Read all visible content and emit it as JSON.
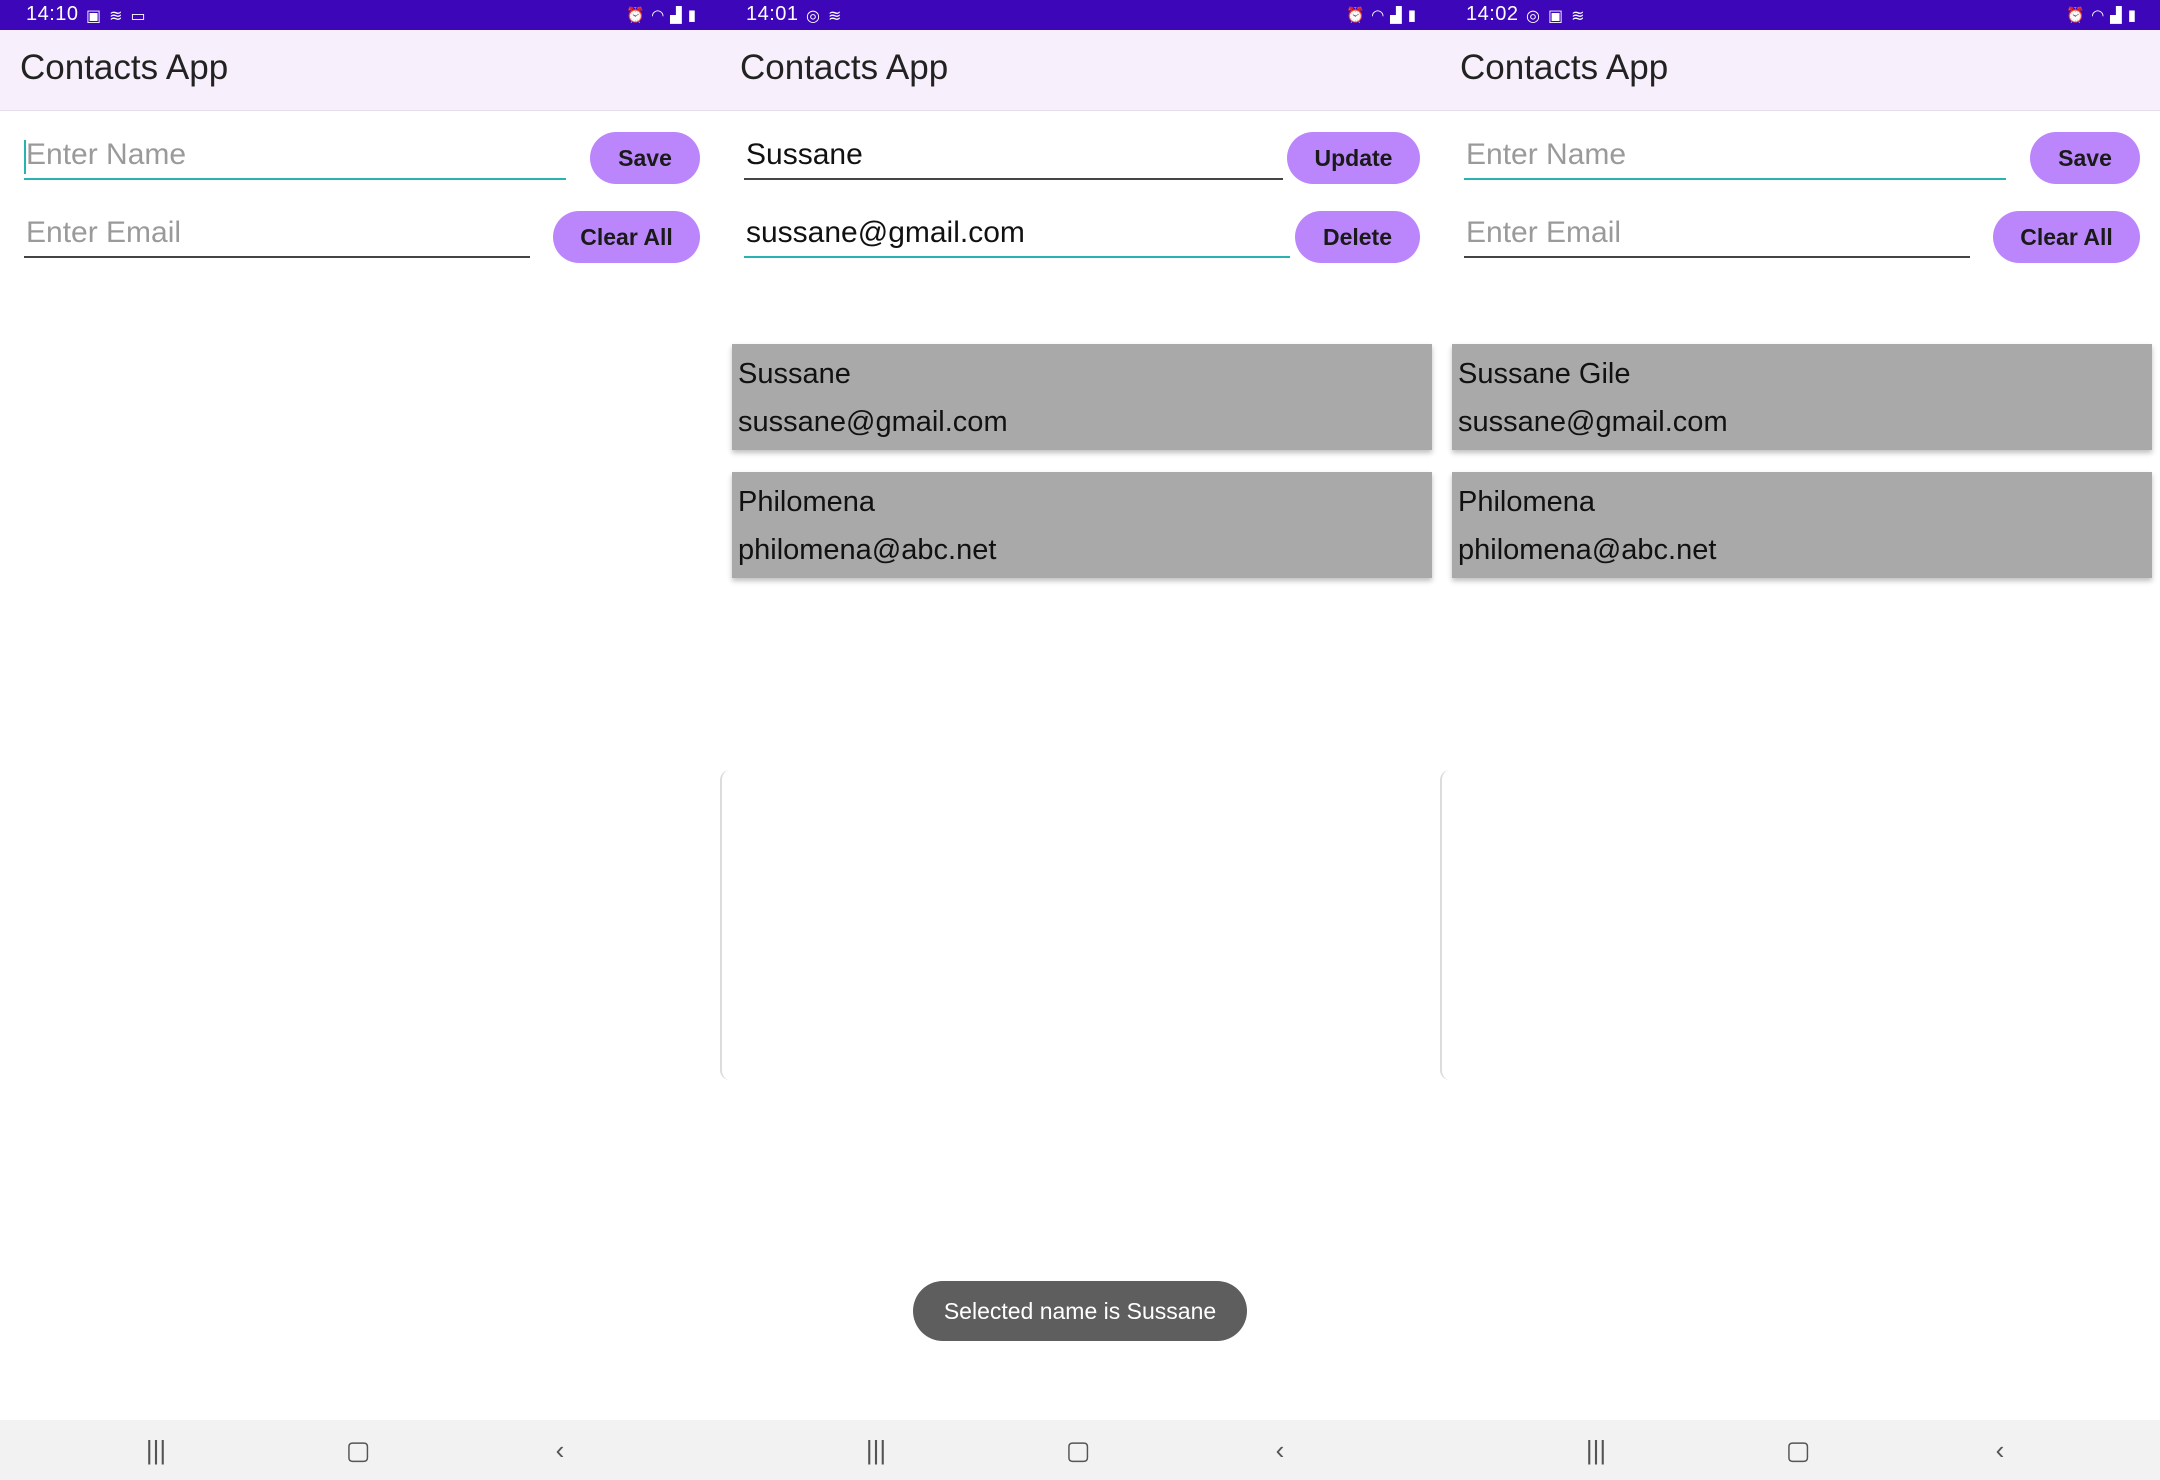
{
  "panels": [
    {
      "time": "14:10",
      "app_title": "Contacts App",
      "name_field": {
        "value": "",
        "placeholder": "Enter Name"
      },
      "email_field": {
        "value": "",
        "placeholder": "Enter Email"
      },
      "primary_button": "Save",
      "secondary_button": "Clear All",
      "contacts": []
    },
    {
      "time": "14:01",
      "app_title": "Contacts App",
      "name_field": {
        "value": "Sussane",
        "placeholder": "Enter Name"
      },
      "email_field": {
        "value": "sussane@gmail.com",
        "placeholder": "Enter Email"
      },
      "primary_button": "Update",
      "secondary_button": "Delete",
      "contacts": [
        {
          "name": "Sussane",
          "email": "sussane@gmail.com"
        },
        {
          "name": "Philomena",
          "email": "philomena@abc.net"
        }
      ],
      "toast": "Selected name is Sussane"
    },
    {
      "time": "14:02",
      "app_title": "Contacts App",
      "name_field": {
        "value": "",
        "placeholder": "Enter Name"
      },
      "email_field": {
        "value": "",
        "placeholder": "Enter Email"
      },
      "primary_button": "Save",
      "secondary_button": "Clear All",
      "contacts": [
        {
          "name": "Sussane Gile",
          "email": "sussane@gmail.com"
        },
        {
          "name": "Philomena",
          "email": "philomena@abc.net"
        }
      ]
    }
  ],
  "icons": {
    "nav_recents": "recent-apps-icon",
    "nav_home": "home-icon",
    "nav_back": "back-icon"
  },
  "colors": {
    "status_bar": "#3d06b8",
    "app_bar": "#f7effb",
    "button": "#bb86fc",
    "card": "#a9a9a9",
    "focus_underline": "#29b3b0"
  }
}
